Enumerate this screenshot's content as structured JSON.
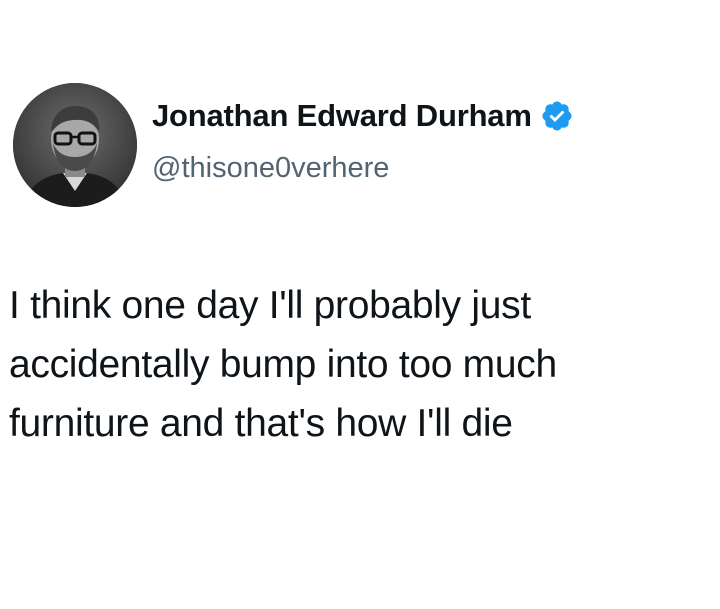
{
  "author": {
    "display_name": "Jonathan Edward Durham",
    "handle": "@thisone0verhere",
    "verified": true,
    "avatar_icon": "profile-photo",
    "verified_icon": "verified-badge-icon"
  },
  "tweet": {
    "lines": [
      "I think one day I'll probably just",
      "accidentally bump into too much",
      "furniture and that's how I'll die"
    ]
  },
  "colors": {
    "verified_blue": "#1d9bf0",
    "text_primary": "#0f1419",
    "text_secondary": "#536471",
    "background": "#ffffff"
  }
}
